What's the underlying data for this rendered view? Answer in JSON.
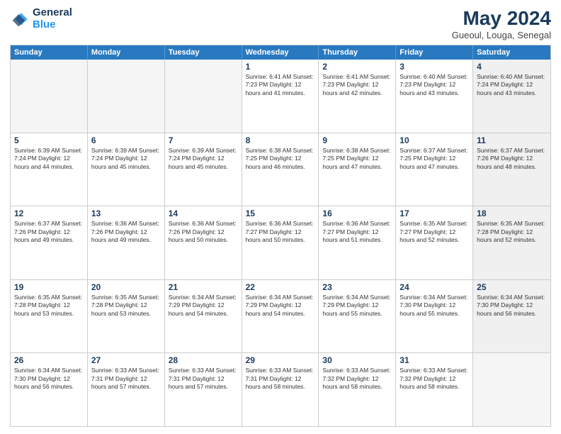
{
  "logo": {
    "line1": "General",
    "line2": "Blue"
  },
  "title": "May 2024",
  "subtitle": "Gueoul, Louga, Senegal",
  "header_days": [
    "Sunday",
    "Monday",
    "Tuesday",
    "Wednesday",
    "Thursday",
    "Friday",
    "Saturday"
  ],
  "weeks": [
    [
      {
        "day": "",
        "info": "",
        "empty": true
      },
      {
        "day": "",
        "info": "",
        "empty": true
      },
      {
        "day": "",
        "info": "",
        "empty": true
      },
      {
        "day": "1",
        "info": "Sunrise: 6:41 AM\nSunset: 7:23 PM\nDaylight: 12 hours\nand 41 minutes."
      },
      {
        "day": "2",
        "info": "Sunrise: 6:41 AM\nSunset: 7:23 PM\nDaylight: 12 hours\nand 42 minutes."
      },
      {
        "day": "3",
        "info": "Sunrise: 6:40 AM\nSunset: 7:23 PM\nDaylight: 12 hours\nand 43 minutes."
      },
      {
        "day": "4",
        "info": "Sunrise: 6:40 AM\nSunset: 7:24 PM\nDaylight: 12 hours\nand 43 minutes.",
        "shaded": true
      }
    ],
    [
      {
        "day": "5",
        "info": "Sunrise: 6:39 AM\nSunset: 7:24 PM\nDaylight: 12 hours\nand 44 minutes."
      },
      {
        "day": "6",
        "info": "Sunrise: 6:39 AM\nSunset: 7:24 PM\nDaylight: 12 hours\nand 45 minutes."
      },
      {
        "day": "7",
        "info": "Sunrise: 6:39 AM\nSunset: 7:24 PM\nDaylight: 12 hours\nand 45 minutes."
      },
      {
        "day": "8",
        "info": "Sunrise: 6:38 AM\nSunset: 7:25 PM\nDaylight: 12 hours\nand 46 minutes."
      },
      {
        "day": "9",
        "info": "Sunrise: 6:38 AM\nSunset: 7:25 PM\nDaylight: 12 hours\nand 47 minutes."
      },
      {
        "day": "10",
        "info": "Sunrise: 6:37 AM\nSunset: 7:25 PM\nDaylight: 12 hours\nand 47 minutes."
      },
      {
        "day": "11",
        "info": "Sunrise: 6:37 AM\nSunset: 7:26 PM\nDaylight: 12 hours\nand 48 minutes.",
        "shaded": true
      }
    ],
    [
      {
        "day": "12",
        "info": "Sunrise: 6:37 AM\nSunset: 7:26 PM\nDaylight: 12 hours\nand 49 minutes."
      },
      {
        "day": "13",
        "info": "Sunrise: 6:36 AM\nSunset: 7:26 PM\nDaylight: 12 hours\nand 49 minutes."
      },
      {
        "day": "14",
        "info": "Sunrise: 6:36 AM\nSunset: 7:26 PM\nDaylight: 12 hours\nand 50 minutes."
      },
      {
        "day": "15",
        "info": "Sunrise: 6:36 AM\nSunset: 7:27 PM\nDaylight: 12 hours\nand 50 minutes."
      },
      {
        "day": "16",
        "info": "Sunrise: 6:36 AM\nSunset: 7:27 PM\nDaylight: 12 hours\nand 51 minutes."
      },
      {
        "day": "17",
        "info": "Sunrise: 6:35 AM\nSunset: 7:27 PM\nDaylight: 12 hours\nand 52 minutes."
      },
      {
        "day": "18",
        "info": "Sunrise: 6:35 AM\nSunset: 7:28 PM\nDaylight: 12 hours\nand 52 minutes.",
        "shaded": true
      }
    ],
    [
      {
        "day": "19",
        "info": "Sunrise: 6:35 AM\nSunset: 7:28 PM\nDaylight: 12 hours\nand 53 minutes."
      },
      {
        "day": "20",
        "info": "Sunrise: 6:35 AM\nSunset: 7:28 PM\nDaylight: 12 hours\nand 53 minutes."
      },
      {
        "day": "21",
        "info": "Sunrise: 6:34 AM\nSunset: 7:29 PM\nDaylight: 12 hours\nand 54 minutes."
      },
      {
        "day": "22",
        "info": "Sunrise: 6:34 AM\nSunset: 7:29 PM\nDaylight: 12 hours\nand 54 minutes."
      },
      {
        "day": "23",
        "info": "Sunrise: 6:34 AM\nSunset: 7:29 PM\nDaylight: 12 hours\nand 55 minutes."
      },
      {
        "day": "24",
        "info": "Sunrise: 6:34 AM\nSunset: 7:30 PM\nDaylight: 12 hours\nand 55 minutes."
      },
      {
        "day": "25",
        "info": "Sunrise: 6:34 AM\nSunset: 7:30 PM\nDaylight: 12 hours\nand 56 minutes.",
        "shaded": true
      }
    ],
    [
      {
        "day": "26",
        "info": "Sunrise: 6:34 AM\nSunset: 7:30 PM\nDaylight: 12 hours\nand 56 minutes."
      },
      {
        "day": "27",
        "info": "Sunrise: 6:33 AM\nSunset: 7:31 PM\nDaylight: 12 hours\nand 57 minutes."
      },
      {
        "day": "28",
        "info": "Sunrise: 6:33 AM\nSunset: 7:31 PM\nDaylight: 12 hours\nand 57 minutes."
      },
      {
        "day": "29",
        "info": "Sunrise: 6:33 AM\nSunset: 7:31 PM\nDaylight: 12 hours\nand 58 minutes."
      },
      {
        "day": "30",
        "info": "Sunrise: 6:33 AM\nSunset: 7:32 PM\nDaylight: 12 hours\nand 58 minutes."
      },
      {
        "day": "31",
        "info": "Sunrise: 6:33 AM\nSunset: 7:32 PM\nDaylight: 12 hours\nand 58 minutes."
      },
      {
        "day": "",
        "info": "",
        "empty": true
      }
    ]
  ]
}
